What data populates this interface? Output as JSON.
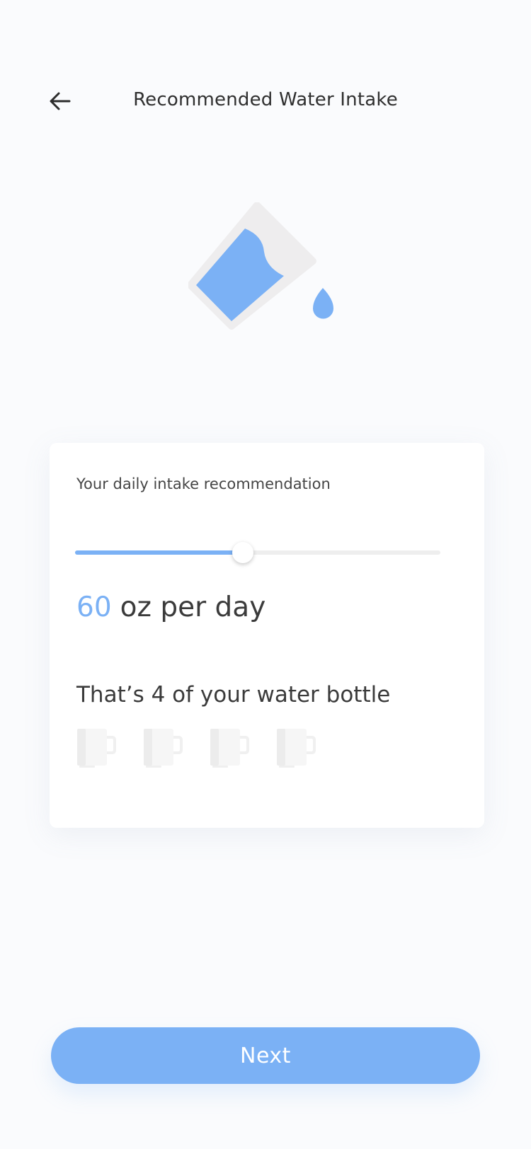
{
  "header": {
    "title": "Recommended Water Intake",
    "back_icon": "arrow-left-icon"
  },
  "illustration": {
    "icon": "pouring-water-glass-icon"
  },
  "card": {
    "label": "Your daily intake recommendation",
    "slider_fraction": 0.46,
    "amount_value": "60",
    "amount_unit": "oz per day",
    "bottle_text": "That’s 4 of your water bottle",
    "mug_count": 4,
    "mug_icon": "mug-icon"
  },
  "footer": {
    "next_label": "Next"
  },
  "colors": {
    "accent": "#7bb1f5",
    "background": "#fafbfd",
    "text": "#3b3b3b",
    "glass": "#eeedee",
    "track": "#eeeeee"
  }
}
